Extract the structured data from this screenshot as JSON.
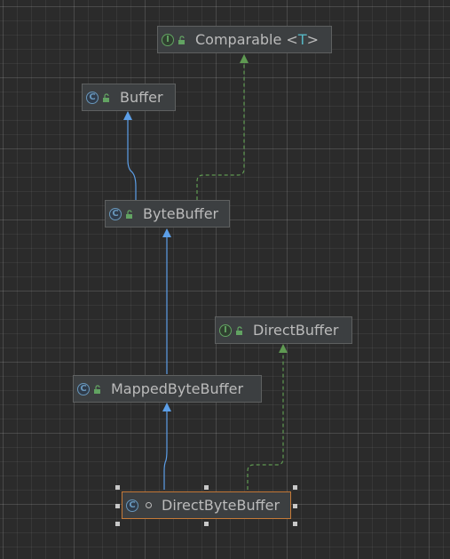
{
  "diagram": {
    "nodes": {
      "comparable": {
        "name": "Comparable <",
        "type_param": "T",
        "suffix": ">",
        "kind": "interface",
        "kind_letter": "I",
        "visibility": "public"
      },
      "buffer": {
        "name": "Buffer",
        "kind": "class",
        "kind_letter": "C",
        "visibility": "public"
      },
      "bytebuffer": {
        "name": "ByteBuffer",
        "kind": "class",
        "kind_letter": "C",
        "visibility": "public"
      },
      "directbuffer": {
        "name": "DirectBuffer",
        "kind": "interface",
        "kind_letter": "I",
        "visibility": "public"
      },
      "mappedbytebuffer": {
        "name": "MappedByteBuffer",
        "kind": "class",
        "kind_letter": "C",
        "visibility": "public"
      },
      "directbytebuffer": {
        "name": "DirectByteBuffer",
        "kind": "class",
        "kind_letter": "C",
        "visibility": "package-private",
        "selected": true
      }
    },
    "edges": [
      {
        "from": "ByteBuffer",
        "to": "Buffer",
        "relation": "extends"
      },
      {
        "from": "ByteBuffer",
        "to": "Comparable",
        "relation": "implements"
      },
      {
        "from": "MappedByteBuffer",
        "to": "ByteBuffer",
        "relation": "extends"
      },
      {
        "from": "DirectByteBuffer",
        "to": "MappedByteBuffer",
        "relation": "extends"
      },
      {
        "from": "DirectByteBuffer",
        "to": "DirectBuffer",
        "relation": "implements"
      }
    ],
    "colors": {
      "background": "#2b2b2b",
      "extends_edge": "#5c9fe8",
      "implements_edge": "#5f9a52",
      "node_fill": "#3c3f41",
      "selection_border": "#c57a38"
    }
  }
}
